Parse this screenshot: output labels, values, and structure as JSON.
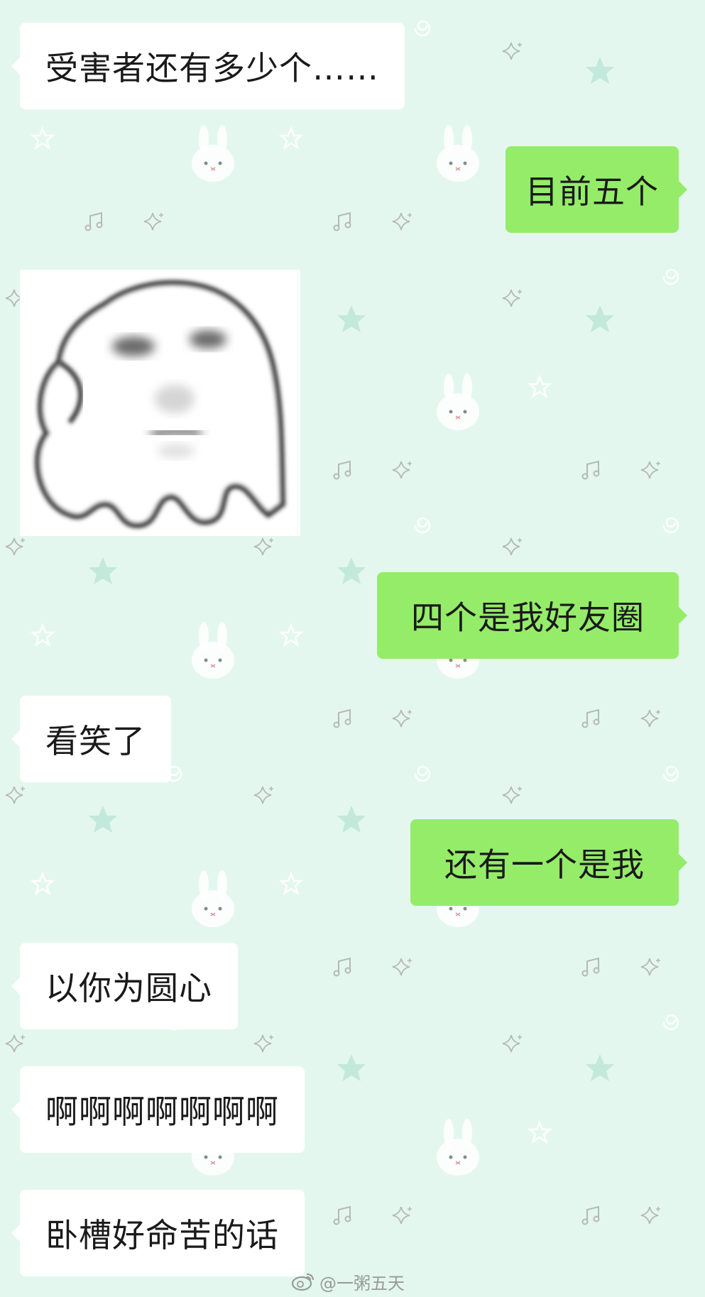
{
  "chat": {
    "messages": [
      {
        "side": "left",
        "type": "text",
        "text": "受害者还有多少个……"
      },
      {
        "side": "right",
        "type": "text",
        "text": "目前五个"
      },
      {
        "side": "left",
        "type": "sticker",
        "icon": "ghost-blob-sticker"
      },
      {
        "side": "right",
        "type": "text",
        "text": "四个是我好友圈"
      },
      {
        "side": "left",
        "type": "text",
        "text": "看笑了"
      },
      {
        "side": "right",
        "type": "text",
        "text": "还有一个是我"
      },
      {
        "side": "left",
        "type": "text",
        "text": "以你为圆心"
      },
      {
        "side": "left",
        "type": "text",
        "text": "啊啊啊啊啊啊啊"
      },
      {
        "side": "left",
        "type": "text",
        "text": "卧槽好命苦的话"
      }
    ]
  },
  "watermark": {
    "icon": "weibo-logo-icon",
    "text": "@一粥五天"
  },
  "colors": {
    "background": "#e3f7ef",
    "incoming_bubble": "#ffffff",
    "outgoing_bubble": "#95ec69",
    "text": "#1a1a1a"
  },
  "background_pattern": {
    "icons": [
      "bunny-icon",
      "star-outline-icon",
      "star-filled-icon",
      "music-note-icon",
      "sparkle-icon",
      "swirl-icon"
    ]
  }
}
